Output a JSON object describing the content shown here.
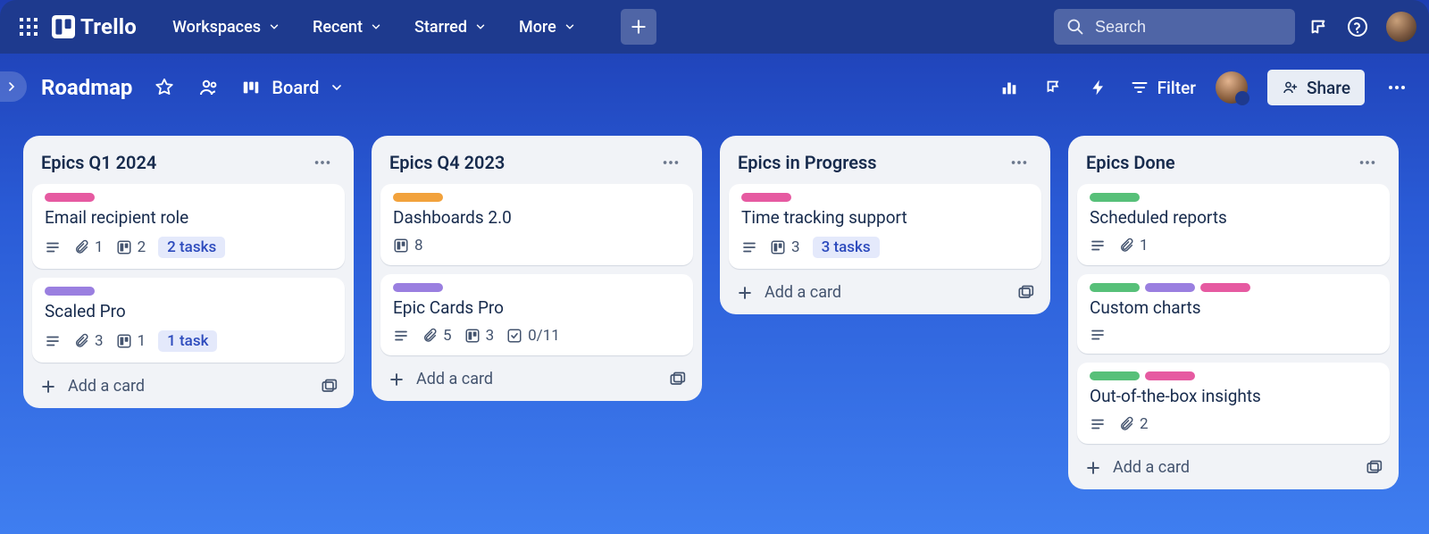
{
  "nav": {
    "logo_text": "Trello",
    "menus": {
      "workspaces": "Workspaces",
      "recent": "Recent",
      "starred": "Starred",
      "more": "More"
    },
    "search_placeholder": "Search"
  },
  "boardbar": {
    "title": "Roadmap",
    "view_label": "Board",
    "filter_label": "Filter",
    "share_label": "Share"
  },
  "lists": [
    {
      "title": "Epics Q1 2024",
      "cards": [
        {
          "title": "Email recipient role",
          "labels": [
            "pink"
          ],
          "desc": true,
          "attachments": "1",
          "trello": "2",
          "tasks": "2 tasks"
        },
        {
          "title": "Scaled Pro",
          "labels": [
            "purple"
          ],
          "desc": true,
          "attachments": "3",
          "trello": "1",
          "tasks": "1 task"
        }
      ],
      "add": "Add a card"
    },
    {
      "title": "Epics Q4 2023",
      "cards": [
        {
          "title": "Dashboards 2.0",
          "labels": [
            "orange"
          ],
          "trello": "8"
        },
        {
          "title": "Epic Cards Pro",
          "labels": [
            "purple"
          ],
          "desc": true,
          "attachments": "5",
          "trello": "3",
          "checklist": "0/11"
        }
      ],
      "add": "Add a card"
    },
    {
      "title": "Epics in Progress",
      "cards": [
        {
          "title": "Time tracking support",
          "labels": [
            "pink"
          ],
          "desc": true,
          "trello": "3",
          "tasks": "3 tasks"
        }
      ],
      "add": "Add a card"
    },
    {
      "title": "Epics Done",
      "cards": [
        {
          "title": "Scheduled reports",
          "labels": [
            "green"
          ],
          "desc": true,
          "attachments": "1"
        },
        {
          "title": "Custom charts",
          "labels": [
            "green",
            "purple",
            "pink"
          ],
          "desc": true
        },
        {
          "title": "Out-of-the-box insights",
          "labels": [
            "green",
            "pink"
          ],
          "desc": true,
          "attachments": "2"
        }
      ],
      "add": "Add a card"
    }
  ]
}
